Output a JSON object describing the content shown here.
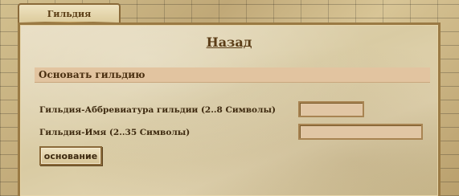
{
  "tab": {
    "label": "Гильдия"
  },
  "header": {
    "back_label": "Назад"
  },
  "section": {
    "title": "Основать гильдию"
  },
  "form": {
    "abbr_label": "Гильдия-Аббревиатура гильдии (2..8 Символы)",
    "abbr_value": "",
    "name_label": "Гильдия-Имя (2..35 Символы)",
    "name_value": "",
    "submit_label": "основание"
  }
}
